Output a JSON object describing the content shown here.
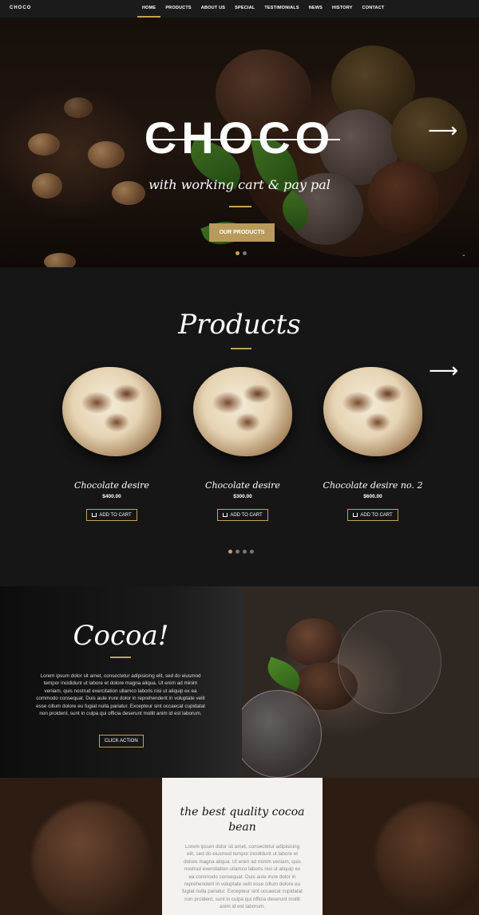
{
  "nav": {
    "logo": "CHOCO",
    "items": [
      "HOME",
      "PRODUCTS",
      "ABOUT US",
      "SPECIAL",
      "TESTIMONIALS",
      "NEWS",
      "HISTORY",
      "CONTACT"
    ],
    "active": "HOME"
  },
  "hero": {
    "title": "CHOCO",
    "subtitle": "with working cart & pay pal",
    "button": "OUR PRODUCTS",
    "slides": 2,
    "active_slide": 1
  },
  "products": {
    "title": "Products",
    "items": [
      {
        "name": "Chocolate desire",
        "price": "$400.00",
        "button": "ADD TO CART"
      },
      {
        "name": "Chocolate desire",
        "price": "$300.00",
        "button": "ADD TO CART"
      },
      {
        "name": "Chocolate desire no. 2",
        "price": "$600.00",
        "button": "ADD TO CART"
      }
    ],
    "pages": 4,
    "active_page": 1
  },
  "cocoa": {
    "title": "Cocoa!",
    "text": "Lorem ipsum dolor sit amet, consectetur adipisicing elit, sed do eiusmod tempor incididunt ut labore et dolore magna aliqua. Ut enim ad minim veniam, quis nostrud exercitation ullamco laboris nisi ut aliquip ex ea commodo consequat. Duis aute irure dolor in reprehenderit in voluptate velit esse cillum dolore eu fugiat nulla pariatur. Excepteur sint occaecat cupidatat non proident, sunt in culpa qui officia deserunt mollit anim id est laborum.",
    "button": "CLICK ACTION"
  },
  "quality": {
    "title": "the best quality cocoa bean",
    "text": "Lorem ipsum dolor sit amet, consectetur adipisicing elit, sed do eiusmod tempor incididunt ut labore et dolore magna aliqua. Ut enim ad minim veniam, quis nostrud exercitation ullamco laboris nisi ut aliquip ex ea commodo consequat. Duis aute irure dolor in reprehenderit in voluptate velit esse cillum dolore eu fugiat nulla pariatur. Excepteur sint occaecat cupidatat non proident, sunt in culpa qui officia deserunt mollit anim id est laborum."
  },
  "colors": {
    "accent": "#c4a15a",
    "button_fill": "#b99a5c",
    "dark_bg": "#161616",
    "card_bg": "#f3f2ef"
  },
  "icons": [
    "next-arrow-icon",
    "cart-icon",
    "scroll-down-icon"
  ]
}
